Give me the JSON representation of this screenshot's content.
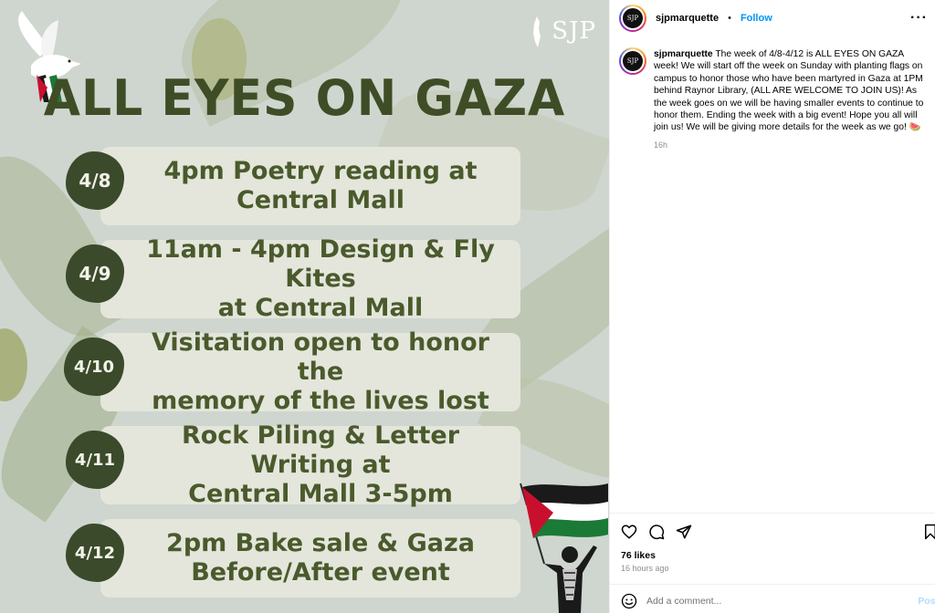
{
  "poster": {
    "title": "ALL EYES ON GAZA",
    "logo_text": "SJP",
    "events": [
      {
        "date": "4/8",
        "text": "4pm Poetry reading at\nCentral Mall"
      },
      {
        "date": "4/9",
        "text": "11am - 4pm Design & Fly Kites\nat Central Mall"
      },
      {
        "date": "4/10",
        "text": "Visitation open to honor the\nmemory of the lives lost"
      },
      {
        "date": "4/11",
        "text": "Rock Piling & Letter Writing at\nCentral Mall 3-5pm"
      },
      {
        "date": "4/12",
        "text": "2pm Bake sale & Gaza\nBefore/After event"
      }
    ],
    "colors": {
      "background": "#cfd6cf",
      "title": "#3f4d27",
      "pill": "#e4e6dc",
      "date_blob": "#3b4a2a",
      "event_text": "#4a5a2c"
    }
  },
  "header": {
    "avatar_text": "SJP",
    "username": "sjpmarquette",
    "separator": "•",
    "follow_label": "Follow",
    "more_icon": "more-horizontal-icon"
  },
  "caption": {
    "username": "sjpmarquette",
    "text": "The week of 4/8-4/12 is ALL EYES ON GAZA week! We will start off the week on Sunday with planting flags on campus to honor those who have been martyred in Gaza at 1PM behind Raynor Library, (ALL ARE WELCOME TO JOIN US)! As the week goes on we will be having smaller events to continue to honor them. Ending the week with a big event! Hope you all will join us! We will be giving more details for the week as we go! 🍉",
    "time": "16h"
  },
  "actions": {
    "icons": [
      "heart-icon",
      "comment-icon",
      "share-icon",
      "bookmark-icon"
    ],
    "likes": "76 likes",
    "posted_ago": "16 hours ago"
  },
  "comment": {
    "placeholder": "Add a comment...",
    "post_label": "Post",
    "emoji_icon": "emoji-icon"
  },
  "colors": {
    "accent": "#0095f6",
    "muted": "#8e8e8e"
  }
}
